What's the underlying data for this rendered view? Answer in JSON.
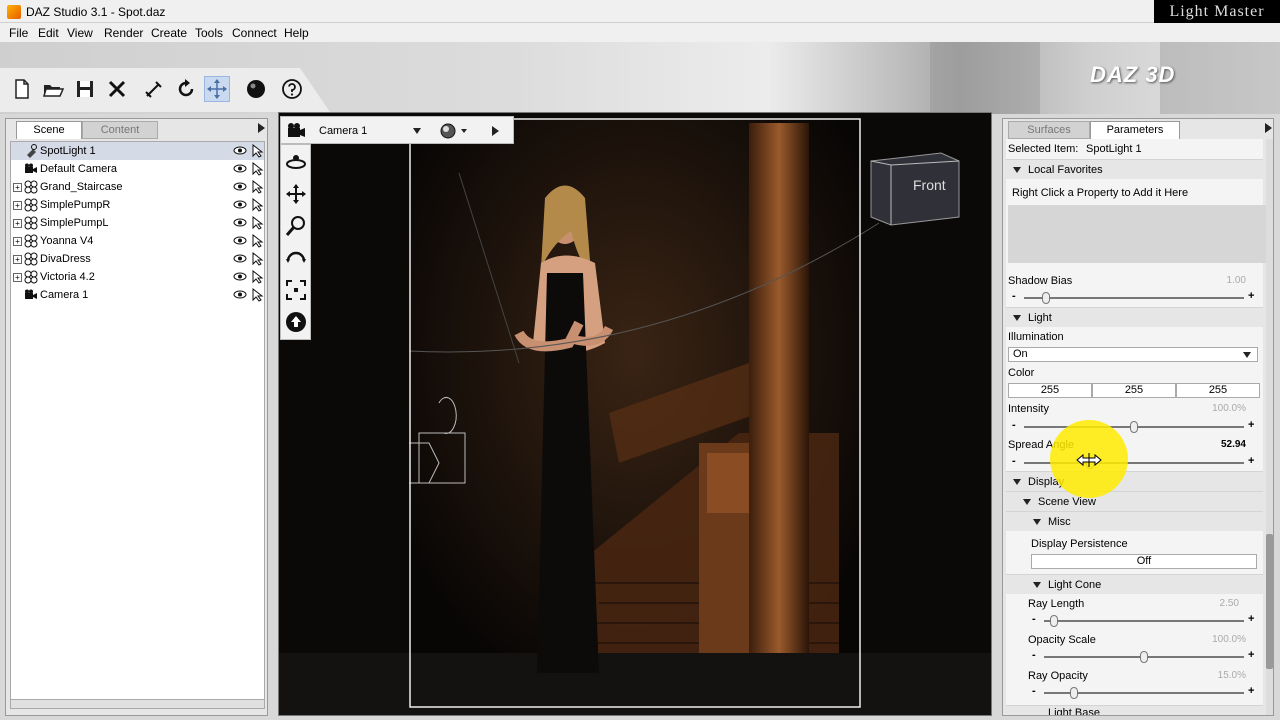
{
  "window": {
    "title": "DAZ Studio 3.1  - Spot.daz",
    "brand": "Light Master"
  },
  "menu": [
    "File",
    "Edit",
    "View",
    "Render",
    "Create",
    "Tools",
    "Connect",
    "Help"
  ],
  "toolbar": {
    "icons": [
      "new-file-icon",
      "open-file-icon",
      "save-icon",
      "close-icon",
      "bone-tool-icon",
      "rotate-tool-icon",
      "move-tool-icon",
      "render-sphere-icon",
      "help-icon"
    ],
    "logo_text": "DAZ 3D"
  },
  "left_panel": {
    "tabs": [
      "Scene",
      "Content"
    ],
    "nodes": [
      {
        "label": "SpotLight 1",
        "type": "light",
        "selected": true,
        "expandable": false
      },
      {
        "label": "Default Camera",
        "type": "camera",
        "selected": false,
        "expandable": false
      },
      {
        "label": "Grand_Staircase",
        "type": "figure",
        "selected": false,
        "expandable": true
      },
      {
        "label": "SimplePumpR",
        "type": "figure",
        "selected": false,
        "expandable": true
      },
      {
        "label": "SimplePumpL",
        "type": "figure",
        "selected": false,
        "expandable": true
      },
      {
        "label": "Yoanna V4",
        "type": "figure",
        "selected": false,
        "expandable": true
      },
      {
        "label": "DivaDress",
        "type": "figure",
        "selected": false,
        "expandable": true
      },
      {
        "label": "Victoria 4.2",
        "type": "figure",
        "selected": false,
        "expandable": true
      },
      {
        "label": "Camera 1",
        "type": "camera",
        "selected": false,
        "expandable": false
      }
    ]
  },
  "viewport": {
    "camera": "Camera 1",
    "cube_label": "Front",
    "side_tools": [
      "camera-icon",
      "orbit-icon",
      "pan-icon",
      "zoom-icon",
      "roll-icon",
      "frame-icon",
      "home-icon"
    ]
  },
  "right_panel": {
    "tabs": [
      "Surfaces",
      "Parameters"
    ],
    "selected_item_label": "Selected Item:",
    "selected_item": "SpotLight 1",
    "local_favorites": "Local Favorites",
    "favorites_hint": "Right Click a Property to Add it Here",
    "shadow_bias": {
      "label": "Shadow Bias",
      "value": "1.00",
      "level": 0.1
    },
    "light_section": "Light",
    "illumination": {
      "label": "Illumination",
      "value": "On"
    },
    "color": {
      "label": "Color",
      "r": "255",
      "g": "255",
      "b": "255"
    },
    "intensity": {
      "label": "Intensity",
      "value": "100.0%",
      "level": 0.5
    },
    "spread_angle": {
      "label": "Spread Angle",
      "value": "52.94",
      "level": 0.3
    },
    "display_section": "Display",
    "scene_view": "Scene View",
    "misc": "Misc",
    "display_persistence": {
      "label": "Display Persistence",
      "value": "Off"
    },
    "light_cone": "Light Cone",
    "ray_length": {
      "label": "Ray Length",
      "value": "2.50",
      "level": 0.05
    },
    "opacity_scale": {
      "label": "Opacity Scale",
      "value": "100.0%",
      "level": 0.5
    },
    "ray_opacity": {
      "label": "Ray Opacity",
      "value": "15.0%",
      "level": 0.15
    },
    "light_base": "Light Base"
  }
}
